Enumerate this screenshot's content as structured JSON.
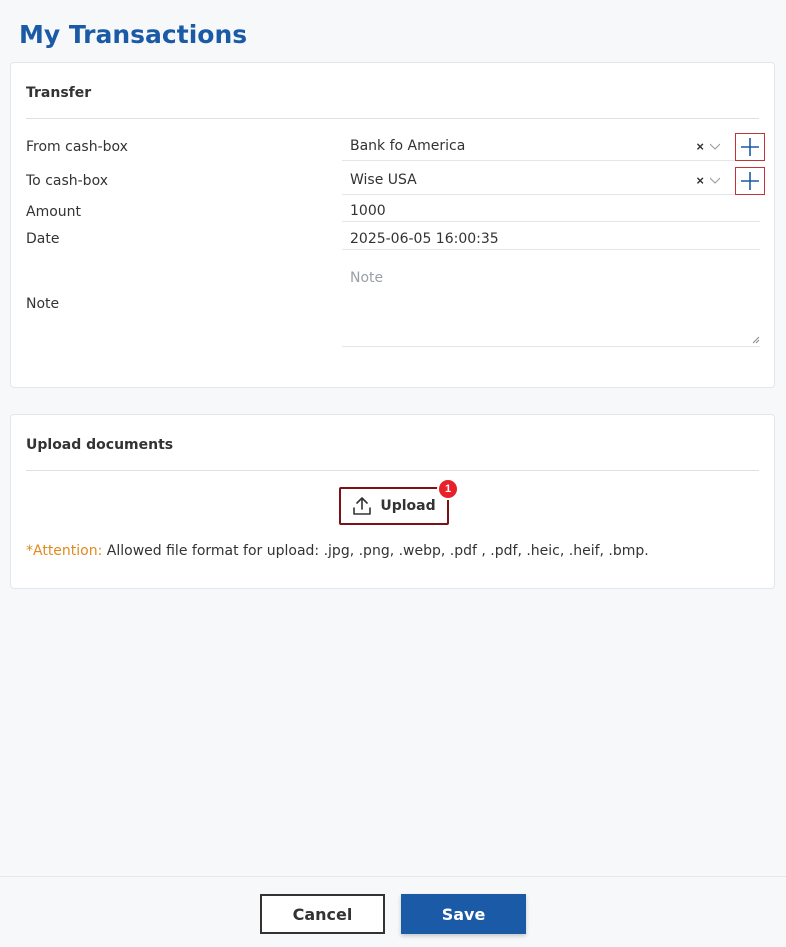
{
  "page": {
    "title": "My Transactions"
  },
  "transfer": {
    "title": "Transfer",
    "from": {
      "label": "From cash-box",
      "value": "Bank fo America"
    },
    "to": {
      "label": "To cash-box",
      "value": "Wise USA"
    },
    "amount": {
      "label": "Amount",
      "value": "1000"
    },
    "date": {
      "label": "Date",
      "value": "2025-06-05 16:00:35"
    },
    "note": {
      "label": "Note",
      "placeholder": "Note"
    },
    "clear_symbol": "×"
  },
  "upload": {
    "title": "Upload documents",
    "button_label": "Upload",
    "badge_count": "1",
    "attention_prefix": "*Attention:",
    "attention_text": " Allowed file format for upload: .jpg, .png, .webp, .pdf , .pdf, .heic, .heif, .bmp."
  },
  "footer": {
    "cancel_label": "Cancel",
    "save_label": "Save"
  },
  "colors": {
    "accent": "#1a5aa6",
    "badge": "#e8202a",
    "warning": "#e08a1e",
    "add_border": "#c0343a"
  }
}
